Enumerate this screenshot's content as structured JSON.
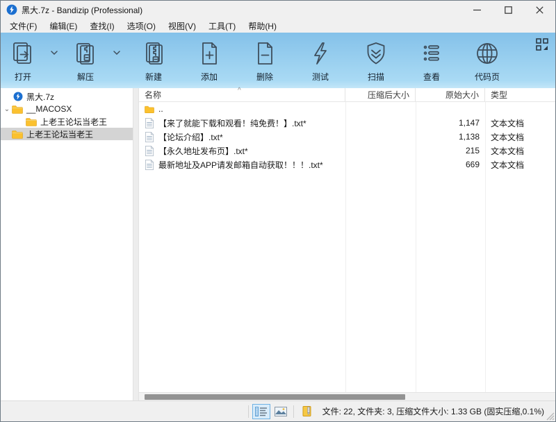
{
  "window": {
    "title": "黑大.7z - Bandizip (Professional)",
    "minimize": "–",
    "maximize": "",
    "close": ""
  },
  "menu": {
    "items": [
      {
        "label": "文件(F)"
      },
      {
        "label": "编辑(E)"
      },
      {
        "label": "查找(I)"
      },
      {
        "label": "选项(O)"
      },
      {
        "label": "视图(V)"
      },
      {
        "label": "工具(T)"
      },
      {
        "label": "帮助(H)"
      }
    ]
  },
  "toolbar": {
    "open": "打开",
    "extract": "解压",
    "new": "新建",
    "add": "添加",
    "delete": "删除",
    "test": "测试",
    "scan": "扫描",
    "view": "查看",
    "codepage": "代码页"
  },
  "tree": {
    "root": "黑大.7z",
    "expander": "⌄",
    "macosx": "__MACOSX",
    "macosx_child": "上老王论坛当老王",
    "selected": "上老王论坛当老王"
  },
  "filelist": {
    "columns": {
      "name": "名称",
      "packed": "压缩后大小",
      "original": "原始大小",
      "type": "类型"
    },
    "sort_indicator": "^",
    "parent_row": "..",
    "rows": [
      {
        "name": "【来了就能下载和观看！纯免费！】.txt*",
        "packed": "",
        "original": "1,147",
        "type": "文本文档"
      },
      {
        "name": "【论坛介绍】.txt*",
        "packed": "",
        "original": "1,138",
        "type": "文本文档"
      },
      {
        "name": "【永久地址发布页】.txt*",
        "packed": "",
        "original": "215",
        "type": "文本文档"
      },
      {
        "name": "最新地址及APP请发邮箱自动获取！！！.txt*",
        "packed": "",
        "original": "669",
        "type": "文本文档"
      }
    ]
  },
  "statusbar": {
    "summary": "文件: 22, 文件夹: 3, 压缩文件大小: 1.33 GB (固实压缩,0.1%)"
  },
  "colors": {
    "toolbar_top": "#84c1e9",
    "toolbar_bottom": "#a9daf4",
    "brand_blue": "#1b6fd0",
    "selection_gray": "#d4d4d4",
    "folder_yellow": "#fbc12f"
  }
}
